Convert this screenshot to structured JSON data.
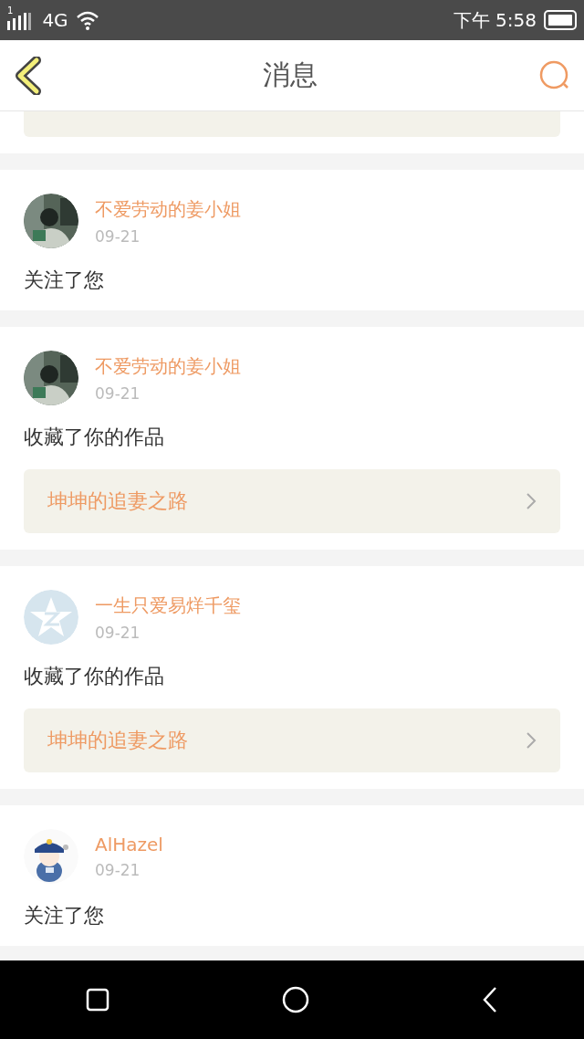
{
  "status_bar": {
    "signal_label": "1",
    "network": "4G",
    "time": "下午 5:58"
  },
  "header": {
    "title": "消息"
  },
  "messages": [
    {
      "kind": "partial_work"
    },
    {
      "kind": "follow",
      "name": "不爱劳动的姜小姐",
      "date": "09-21",
      "action": "关注了您"
    },
    {
      "kind": "favorite",
      "name": "不爱劳动的姜小姐",
      "date": "09-21",
      "action": "收藏了你的作品",
      "work": "坤坤的追妻之路"
    },
    {
      "kind": "favorite",
      "avatar": {
        "kind": "default"
      },
      "name": "一生只爱易烊千玺",
      "date": "09-21",
      "action": "收藏了你的作品",
      "work": "坤坤的追妻之路"
    },
    {
      "kind": "follow",
      "avatar": {
        "kind": "cartoon"
      },
      "name": "AlHazel",
      "date": "09-21",
      "action": "关注了您"
    }
  ]
}
